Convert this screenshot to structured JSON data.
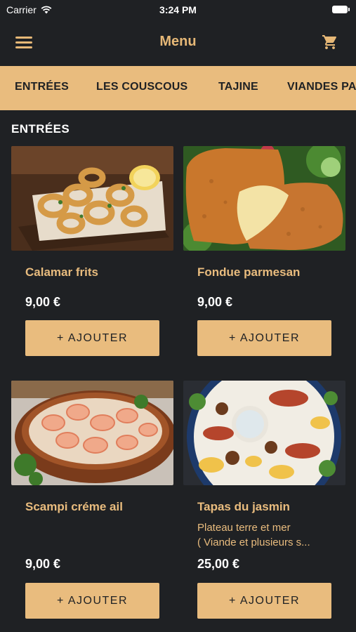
{
  "status_bar": {
    "carrier": "Carrier",
    "time": "3:24 PM"
  },
  "navbar": {
    "title": "Menu",
    "menu_icon": "hamburger-menu-icon",
    "cart_icon": "shopping-cart-icon"
  },
  "categories": [
    "ENTRÉES",
    "LES COUSCOUS",
    "TAJINE",
    "VIANDES PA"
  ],
  "section_title": "ENTRÉES",
  "products": [
    {
      "name": "Calamar frits",
      "description": [],
      "price": "9,00 €",
      "button": "+ AJOUTER"
    },
    {
      "name": "Fondue parmesan",
      "description": [],
      "price": "9,00 €",
      "button": "+ AJOUTER"
    },
    {
      "name": "Scampi créme ail",
      "description": [],
      "price": "9,00 €",
      "button": "+ AJOUTER"
    },
    {
      "name": "Tapas du jasmin",
      "description": [
        "Plateau terre et mer",
        "( Viande et plusieurs s..."
      ],
      "price": "25,00 €",
      "button": "+ AJOUTER"
    }
  ],
  "colors": {
    "background": "#1f2124",
    "accent": "#e9bc7e",
    "text": "#ffffff"
  }
}
